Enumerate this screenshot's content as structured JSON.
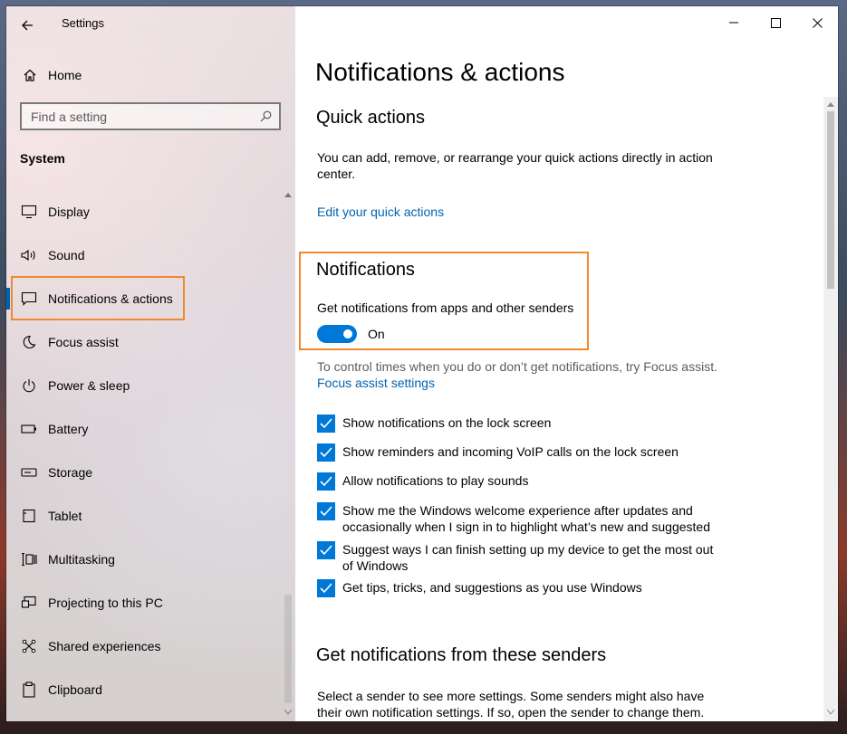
{
  "window": {
    "app_title": "Settings"
  },
  "sidebar": {
    "home_label": "Home",
    "search": {
      "placeholder": "Find a setting"
    },
    "section_label": "System",
    "items": [
      {
        "label": "Display",
        "icon": "monitor-icon"
      },
      {
        "label": "Sound",
        "icon": "speaker-icon"
      },
      {
        "label": "Notifications & actions",
        "icon": "message-icon",
        "active": true
      },
      {
        "label": "Focus assist",
        "icon": "moon-icon"
      },
      {
        "label": "Power & sleep",
        "icon": "power-icon"
      },
      {
        "label": "Battery",
        "icon": "battery-icon"
      },
      {
        "label": "Storage",
        "icon": "storage-icon"
      },
      {
        "label": "Tablet",
        "icon": "tablet-icon"
      },
      {
        "label": "Multitasking",
        "icon": "multitasking-icon"
      },
      {
        "label": "Projecting to this PC",
        "icon": "projector-icon"
      },
      {
        "label": "Shared experiences",
        "icon": "share-icon"
      },
      {
        "label": "Clipboard",
        "icon": "clipboard-icon"
      }
    ]
  },
  "main": {
    "page_title": "Notifications & actions",
    "quick_actions": {
      "heading": "Quick actions",
      "description": "You can add, remove, or rearrange your quick actions directly in action center.",
      "link": "Edit your quick actions"
    },
    "notifications": {
      "heading": "Notifications",
      "toggle_caption": "Get notifications from apps and other senders",
      "toggle_state": "On",
      "focus_hint": "To control times when you do or don’t get notifications, try Focus assist.",
      "focus_link": "Focus assist settings",
      "checkboxes": [
        {
          "label": "Show notifications on the lock screen",
          "checked": true
        },
        {
          "label": "Show reminders and incoming VoIP calls on the lock screen",
          "checked": true
        },
        {
          "label": "Allow notifications to play sounds",
          "checked": true
        },
        {
          "label": "Show me the Windows welcome experience after updates and occasionally when I sign in to highlight what’s new and suggested",
          "checked": true
        },
        {
          "label": "Suggest ways I can finish setting up my device to get the most out of Windows",
          "checked": true
        },
        {
          "label": "Get tips, tricks, and suggestions as you use Windows",
          "checked": true
        }
      ]
    },
    "senders": {
      "heading": "Get notifications from these senders",
      "description": "Select a sender to see more settings. Some senders might also have their own notification settings. If so, open the sender to change them."
    }
  },
  "colors": {
    "accent": "#0078d7",
    "link": "#0063b1",
    "highlight": "#f08a2d"
  }
}
